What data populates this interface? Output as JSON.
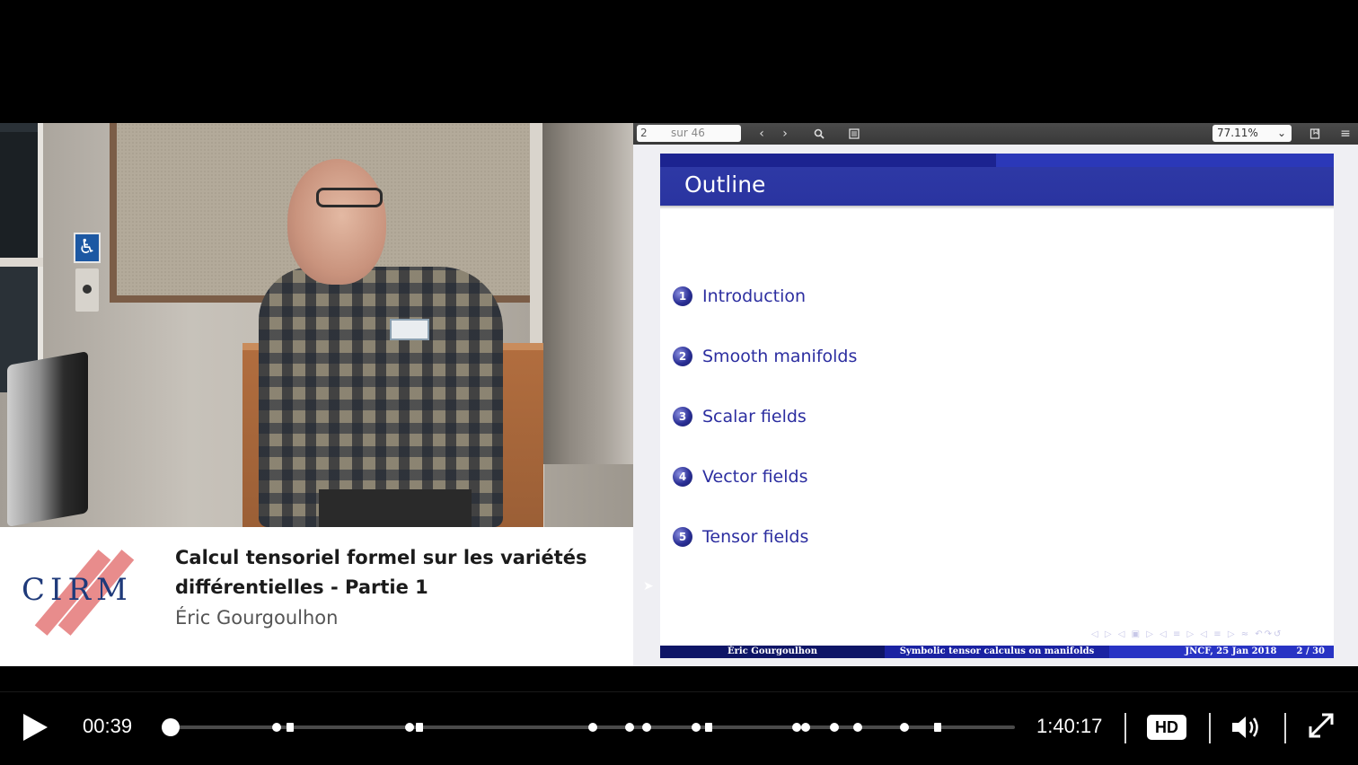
{
  "caption": {
    "logo_text": "CIRM",
    "title": "Calcul tensoriel formel sur les variétés différentielles - Partie 1",
    "author": "Éric Gourgoulhon"
  },
  "pdf_toolbar": {
    "page_value": "2",
    "page_total": "sur 46",
    "zoom": "77.11%",
    "icons": [
      "chevron-left-icon",
      "chevron-right-icon",
      "search-icon",
      "sidebar-icon",
      "bookmark-icon",
      "menu-icon"
    ]
  },
  "slide": {
    "title": "Outline",
    "items": [
      {
        "number": "1",
        "label": "Introduction"
      },
      {
        "number": "2",
        "label": "Smooth manifolds"
      },
      {
        "number": "3",
        "label": "Scalar fields"
      },
      {
        "number": "4",
        "label": "Vector fields"
      },
      {
        "number": "5",
        "label": "Tensor fields"
      }
    ],
    "footer": {
      "author": "Éric Gourgoulhon",
      "title": "Symbolic tensor calculus on manifolds",
      "venue": "JNCF, 25 Jan 2018",
      "page": "2 / 30"
    }
  },
  "player": {
    "current_time": "00:39",
    "duration": "1:40:17",
    "quality": "HD",
    "progress_fraction": 0.0065,
    "colors": {
      "track": "#4a4a4a",
      "marks": "#ffffff"
    }
  }
}
